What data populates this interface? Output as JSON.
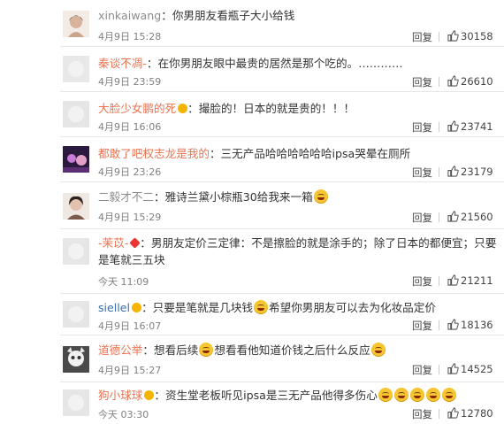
{
  "comments": [
    {
      "name": "xinkaiwang",
      "text": "你男朋友看瓶子大小给钱",
      "time": "4月9日 15:28",
      "likes": "30158"
    },
    {
      "name": "秦谈不凋-",
      "text": "在你男朋友眼中最贵的居然是那个吃的。…………",
      "time": "4月9日 23:59",
      "likes": "26610"
    },
    {
      "name": "大脸少女鹏的死",
      "text": "撮脸的！日本的就是贵的！！！",
      "time": "4月9日 16:06",
      "likes": "23741"
    },
    {
      "name": "都敢了吧权志龙是我的",
      "text": "三无产品哈哈哈哈哈哈ipsa哭晕在厕所",
      "time": "4月9日 23:26",
      "likes": "23179"
    },
    {
      "name": "二毅才不二",
      "text": "雅诗兰黛小棕瓶30给我来一箱",
      "time": "4月9日 15:29",
      "likes": "21560"
    },
    {
      "name": "-茉苡-",
      "text": "男朋友定价三定律：不是擦脸的就是涂手的；除了日本的都便宜；只要是笔就三五块",
      "time": "今天 11:09",
      "likes": "21211"
    },
    {
      "name": "siellel",
      "text": "只要是笔就是几块钱",
      "text2": "希望你男朋友可以去为化妆品定价",
      "time": "4月9日 16:07",
      "likes": "18136"
    },
    {
      "name": "道德公举",
      "text": "想看后续",
      "text2": "想看看他知道价钱之后什么反应",
      "time": "4月9日 15:27",
      "likes": "14525"
    },
    {
      "name": "狗小球球",
      "text": "资生堂老板听见ipsa是三无产品他得多伤心",
      "time": "今天 03:30",
      "likes": "12780"
    }
  ],
  "reply_label": "回复",
  "colors": {
    "name_orange": "#eb7350",
    "name_blue": "#3a6fb0",
    "text": "#333333",
    "time": "#808080"
  }
}
